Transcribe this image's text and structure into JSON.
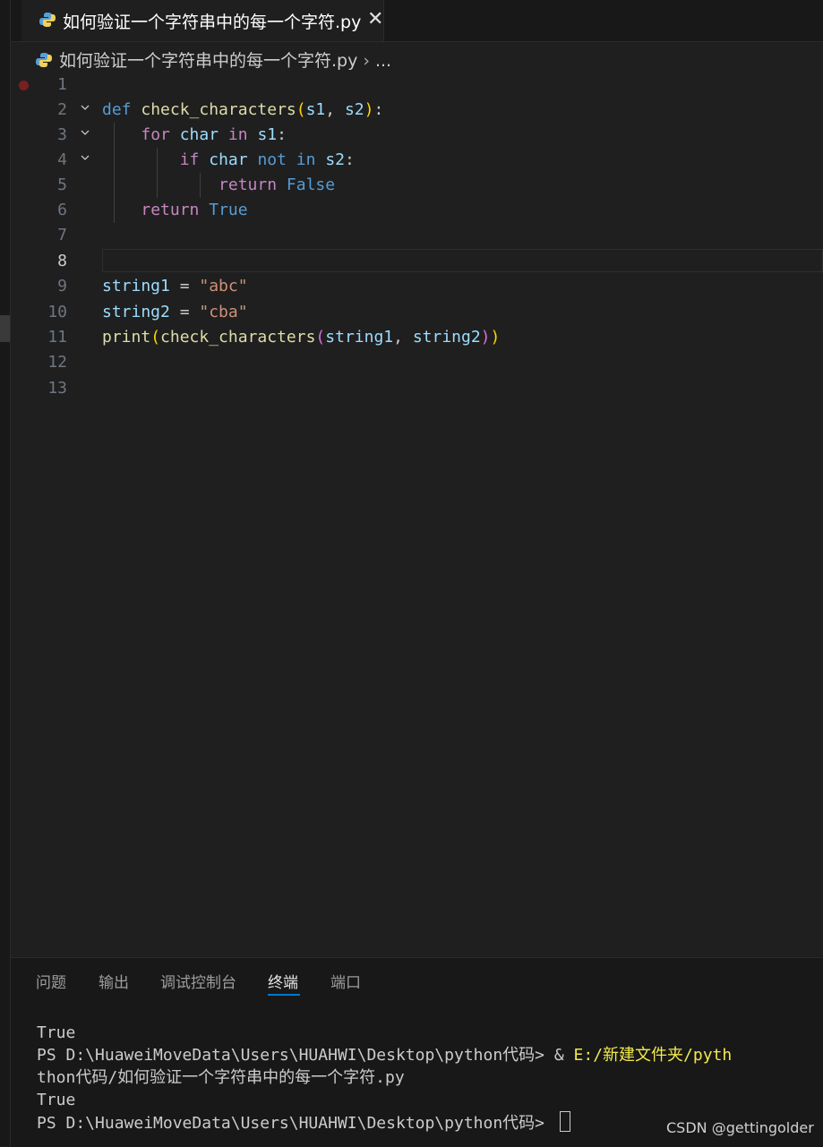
{
  "tab": {
    "label": "如何验证一个字符串中的每一个字符.py",
    "close": "✕"
  },
  "breadcrumb": {
    "file": "如何验证一个字符串中的每一个字符.py",
    "sep": "›",
    "more": "..."
  },
  "editor": {
    "line_numbers": [
      "1",
      "2",
      "3",
      "4",
      "5",
      "6",
      "7",
      "8",
      "9",
      "10",
      "11",
      "12",
      "13"
    ],
    "code": {
      "l2": {
        "def": "def",
        "name": "check_characters",
        "open": "(",
        "a": "s1",
        "comma": ", ",
        "b": "s2",
        "close": ")",
        "colon": ":"
      },
      "l3": {
        "for": "for",
        "var": "char",
        "in": "in",
        "iter": "s1",
        "colon": ":"
      },
      "l4": {
        "if": "if",
        "var": "char",
        "not": "not",
        "in": "in",
        "iter": "s2",
        "colon": ":"
      },
      "l5": {
        "return": "return",
        "value": "False"
      },
      "l6": {
        "return": "return",
        "value": "True"
      },
      "l9": {
        "var": "string1",
        "eq": " = ",
        "value": "\"abc\""
      },
      "l10": {
        "var": "string2",
        "eq": " = ",
        "value": "\"cba\""
      },
      "l11": {
        "fn": "print",
        "o1": "(",
        "call": "check_characters",
        "o2": "(",
        "a": "string1",
        "comma": ", ",
        "b": "string2",
        "c2": ")",
        "c1": ")"
      }
    }
  },
  "panel": {
    "tabs": [
      "问题",
      "输出",
      "调试控制台",
      "终端",
      "端口"
    ],
    "active_tab": "终端",
    "terminal": [
      "True",
      "PS D:\\HuaweiMoveData\\Users\\HUAHWI\\Desktop\\python代码> & ",
      "E:/新建文件夹/pyth",
      "thon代码/如何验证一个字符串中的每一个字符.py",
      "True",
      "PS D:\\HuaweiMoveData\\Users\\HUAHWI\\Desktop\\python代码> "
    ]
  },
  "watermark": "CSDN @gettingolder",
  "icons": {
    "file": "python-icon",
    "fold": "chevron-down-icon"
  },
  "colors": {
    "accent": "#0078d4",
    "keyword": "#569cd6",
    "control": "#c586c0",
    "function": "#dcdcaa",
    "variable": "#9cdcfe",
    "string": "#ce9178"
  }
}
